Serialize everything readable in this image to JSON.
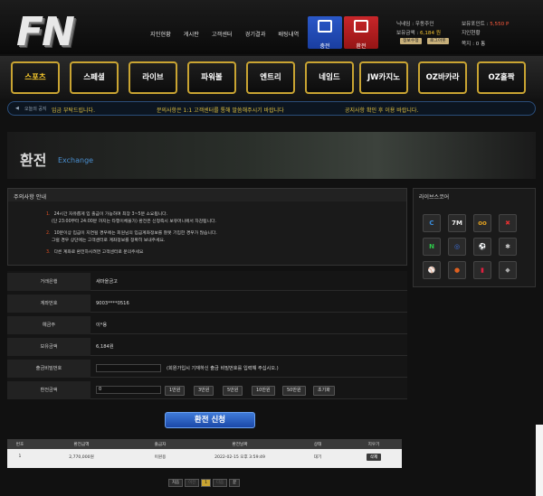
{
  "brand": {
    "logo_text": "FN"
  },
  "topnav": [
    "지인현황",
    "게시판",
    "고객센터",
    "경기결과",
    "배팅내역"
  ],
  "header_buttons": {
    "charge": "충전",
    "exchange": "환전"
  },
  "user": {
    "nickname_label": "닉네임 :",
    "nickname": "우동주인",
    "balance_label": "보유금액 :",
    "balance": "6,184 원",
    "point_label": "보유포인트 :",
    "point": "5,550 P",
    "friends_label": "지인현황",
    "friends_count_label": "쪽지 :",
    "friends_count": "0 통",
    "info_btn": "정보수정",
    "logout_btn": "로그아웃"
  },
  "mainnav": [
    "스포츠",
    "스페셜",
    "라이브",
    "파워볼",
    "엔트리",
    "네임드",
    "JW카지노",
    "OZ바카라",
    "OZ홀짝"
  ],
  "notice": {
    "label": "오늘의 공지",
    "items": [
      "입금 부탁드립니다.",
      "문의사항은 1:1 고객센터를 통해 말씀해주시기 바랍니다",
      "공지사항 확인 후 이용 바랍니다."
    ]
  },
  "banner": {
    "title": "환전",
    "subtitle": "Exchange"
  },
  "warning": {
    "title": "주의사항 안내",
    "lines": [
      {
        "num": "1.",
        "text": "24시간 자유롭게 입 출금이 가능하며 최장 3~5분 소요됩니다."
      },
      {
        "num": "",
        "text": "(단 23:00부터 24:00분 까지는 타행이체불가) 환전은 신청즉시 보유머니에서 차감됩니다."
      },
      {
        "num": "2.",
        "text": "10분이상 입금이 지연될 경우에는 회원님의 입금계좌정보를 잘못 기입한 경우가 많습니다."
      },
      {
        "num": "",
        "text": "그럴 경우 상단에는 고객센터로 계좌정보를 정확히 보내주세요."
      },
      {
        "num": "3.",
        "text": "다른 계좌로 환전하시려면 고객센터로 문의주세요"
      }
    ]
  },
  "livescore": {
    "title": "라이브스코어",
    "icons": [
      "score-c",
      "7M",
      "oo",
      "xx",
      "N",
      "ball",
      "soccer",
      "stars",
      "mlb",
      "nba",
      "basket",
      "nhl"
    ]
  },
  "form": {
    "bank_label": "거래은행",
    "bank": "새마을금고",
    "account_label": "계좌번호",
    "account": "9003****0516",
    "holder_label": "예금주",
    "holder": "이*용",
    "balance_label": "보유금액",
    "balance": "6,184원",
    "pw_label": "출금비밀번호",
    "pw_hint": "(회원가입시 기재하신 출금 비밀번호를 입력해 주십시오.)",
    "amount_label": "환전금액",
    "amount_value": "0",
    "amount_buttons": [
      "1만원",
      "3만원",
      "5만원",
      "10만원",
      "50만원",
      "초기화"
    ]
  },
  "submit_label": "환전 신청",
  "history": {
    "headers": [
      "번호",
      "환전금액",
      "출금자",
      "환전날짜",
      "상태",
      "지우기"
    ],
    "rows": [
      {
        "no": "1",
        "amount": "2,770,000원",
        "name": "이원용",
        "date": "2022-02-15 오후 3:59:49",
        "status": "대기",
        "del": "삭제"
      }
    ]
  },
  "pager": [
    "처음",
    "이전",
    "1",
    "다음",
    "끝"
  ]
}
